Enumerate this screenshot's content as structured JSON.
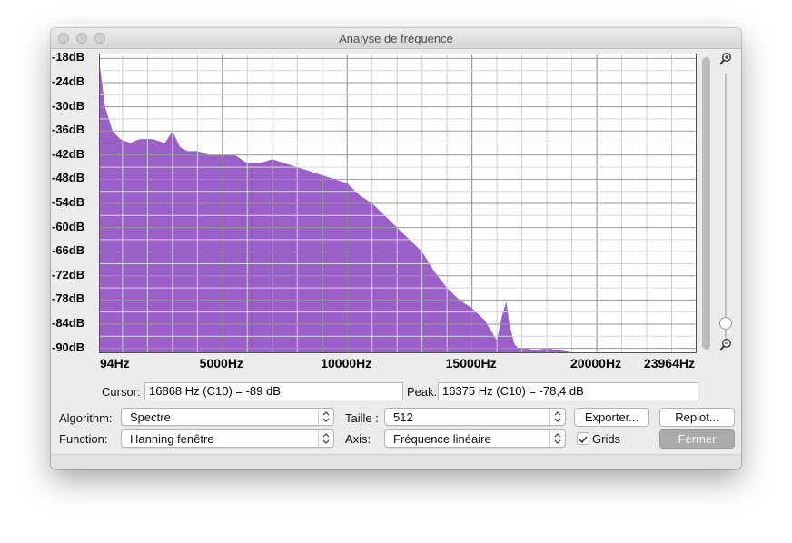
{
  "window": {
    "title": "Analyse de fréquence"
  },
  "chart_data": {
    "type": "area",
    "color": "#9b5fc9",
    "ylabels": [
      "-18dB",
      "-24dB",
      "-30dB",
      "-36dB",
      "-42dB",
      "-48dB",
      "-54dB",
      "-60dB",
      "-66dB",
      "-72dB",
      "-78dB",
      "-84dB",
      "-90dB"
    ],
    "xlabels": [
      "94Hz",
      "5000Hz",
      "10000Hz",
      "15000Hz",
      "20000Hz",
      "23964Hz"
    ],
    "xlim": [
      94,
      23964
    ],
    "ylim": [
      -91,
      -17
    ],
    "x": [
      94,
      300,
      600,
      900,
      1300,
      1700,
      2200,
      2700,
      3000,
      3300,
      3600,
      4000,
      4500,
      5000,
      5500,
      6000,
      6500,
      7000,
      7500,
      8000,
      8500,
      9000,
      9500,
      10000,
      10500,
      11000,
      11500,
      12000,
      12500,
      13000,
      13500,
      14000,
      14500,
      15000,
      15500,
      15800,
      16000,
      16200,
      16375,
      16500,
      16700,
      16868,
      17200,
      17500,
      18000,
      18500,
      19000
    ],
    "y": [
      -20,
      -30,
      -36,
      -38,
      -39,
      -38,
      -38,
      -39,
      -36,
      -40,
      -41,
      -41,
      -42,
      -42,
      -42,
      -44,
      -44,
      -43,
      -44,
      -45,
      -46,
      -47,
      -48,
      -49,
      -52,
      -54,
      -57,
      -60,
      -63,
      -66,
      -71,
      -75,
      -78,
      -80,
      -83,
      -86,
      -88,
      -82,
      -78.4,
      -84,
      -89,
      -90,
      -90,
      -90.5,
      -90,
      -90.5,
      -91
    ],
    "grid": true
  },
  "cursor": {
    "label": "Cursor:",
    "value": "16868 Hz (C10) = -89 dB"
  },
  "peak": {
    "label": "Peak:",
    "value": "16375 Hz (C10) = -78,4 dB"
  },
  "controls": {
    "algorithm_label": "Algorithm:",
    "algorithm_value": "Spectre",
    "function_label": "Function:",
    "function_value": "Hanning fenêtre",
    "taille_label": "Taille :",
    "taille_value": "512",
    "axis_label": "Axis:",
    "axis_value": "Fréquence linéaire",
    "export_label": "Exporter...",
    "replot_label": "Replot...",
    "grids_label": "Grids",
    "grids_checked": true,
    "close_label": "Fermer"
  }
}
